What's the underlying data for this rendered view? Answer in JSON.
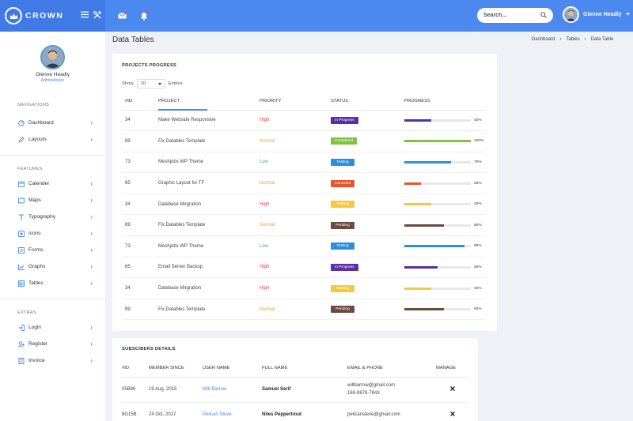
{
  "brand": {
    "name": "CROWN"
  },
  "header": {
    "search_placeholder": "Search...",
    "user_name": "Glenne Headly"
  },
  "sidebar": {
    "profile": {
      "name": "Glenne Headly",
      "role": "Administrator"
    },
    "sections": [
      {
        "title": "NAVIGATIONS",
        "items": [
          {
            "label": "Dashboard",
            "icon": "dashboard-icon"
          },
          {
            "label": "Layouts",
            "icon": "pencil-icon"
          }
        ]
      },
      {
        "title": "FEATURES",
        "items": [
          {
            "label": "Calender",
            "icon": "calendar-icon"
          },
          {
            "label": "Maps",
            "icon": "map-icon"
          },
          {
            "label": "Typography",
            "icon": "typography-icon"
          },
          {
            "label": "Icons",
            "icon": "icons-icon"
          },
          {
            "label": "Forms",
            "icon": "forms-icon"
          },
          {
            "label": "Graphs",
            "icon": "graph-icon"
          },
          {
            "label": "Tables",
            "icon": "table-icon"
          }
        ]
      },
      {
        "title": "EXTRAS",
        "items": [
          {
            "label": "Login",
            "icon": "login-icon"
          },
          {
            "label": "Register",
            "icon": "register-icon"
          },
          {
            "label": "Invoice",
            "icon": "invoice-icon"
          }
        ]
      }
    ]
  },
  "page": {
    "title": "Data Tables",
    "breadcrumb": [
      "Dashboard",
      "Tables",
      "Data Table"
    ]
  },
  "projects": {
    "title": "PROJECTS PROGRESS",
    "show_label": "Show",
    "show_value": "10",
    "entries_label": "Entries",
    "columns": [
      "#ID",
      "PROJECT",
      "PRIORITY",
      "STATUS",
      "PROGRESS"
    ],
    "rows": [
      {
        "id": "34",
        "project": "Make Webside Responsive",
        "priority": "High",
        "status": "In Progress",
        "status_color": "#5b2ea6",
        "progress": 40,
        "progress_label": "40%",
        "bar_color": "#5b2ea6"
      },
      {
        "id": "89",
        "project": "Fix Datables Template",
        "priority": "Normal",
        "status": "Completed",
        "status_color": "#7fc241",
        "progress": 100,
        "progress_label": "100%",
        "bar_color": "#7fc241"
      },
      {
        "id": "73",
        "project": "Meshjobs WP Theme",
        "priority": "Low",
        "status": "Testing",
        "status_color": "#2b8fe0",
        "progress": 70,
        "progress_label": "70%",
        "bar_color": "#2b8fe0"
      },
      {
        "id": "65",
        "project": "Graphic Layout for TF",
        "priority": "Normal",
        "status": "Canceled",
        "status_color": "#e8542f",
        "progress": 25,
        "progress_label": "25%",
        "bar_color": "#e8542f"
      },
      {
        "id": "34",
        "project": "Datebase Mirgration",
        "priority": "High",
        "status": "Waiting",
        "status_color": "#f5c93a",
        "progress": 40,
        "progress_label": "40%",
        "bar_color": "#f5c93a"
      },
      {
        "id": "89",
        "project": "Fix Datables Template",
        "priority": "Normal",
        "status": "Pending",
        "status_color": "#6d4a3f",
        "progress": 60,
        "progress_label": "60%",
        "bar_color": "#6d4a3f"
      },
      {
        "id": "73",
        "project": "Meshjobs WP Theme",
        "priority": "Low",
        "status": "Testing",
        "status_color": "#2b8fe0",
        "progress": 90,
        "progress_label": "90%",
        "bar_color": "#2b8fe0"
      },
      {
        "id": "65",
        "project": "Email Server Backup",
        "priority": "High",
        "status": "In Progress",
        "status_color": "#5b2ea6",
        "progress": 50,
        "progress_label": "50%",
        "bar_color": "#5b2ea6"
      },
      {
        "id": "34",
        "project": "Datebase Mirgration",
        "priority": "High",
        "status": "Waiting",
        "status_color": "#f5c93a",
        "progress": 40,
        "progress_label": "40%",
        "bar_color": "#f5c93a"
      },
      {
        "id": "89",
        "project": "Fix Datables Template",
        "priority": "Normal",
        "status": "Pending",
        "status_color": "#6d4a3f",
        "progress": 60,
        "progress_label": "60%",
        "bar_color": "#6d4a3f"
      }
    ]
  },
  "subscribers": {
    "title": "SUBSCIBERS DETAILS",
    "columns": [
      "#ID",
      "MEMBER SINCE",
      "USER NAME",
      "FULL NAME",
      "EMAIL & PHONE",
      "MANAGE"
    ],
    "rows": [
      {
        "id": "05B86",
        "since": "19 Aug, 2015",
        "username": "Will Barrow",
        "fullname": "Samuel Serif",
        "email": "willbarrow@gmail.com",
        "phone": "169-9878-7843"
      },
      {
        "id": "8G15B",
        "since": "24 Oct, 2017",
        "username": "Pelican Steve",
        "fullname": "Niles Peppertrout",
        "email": "pelicansteve@gmail.com",
        "phone": ""
      }
    ]
  }
}
